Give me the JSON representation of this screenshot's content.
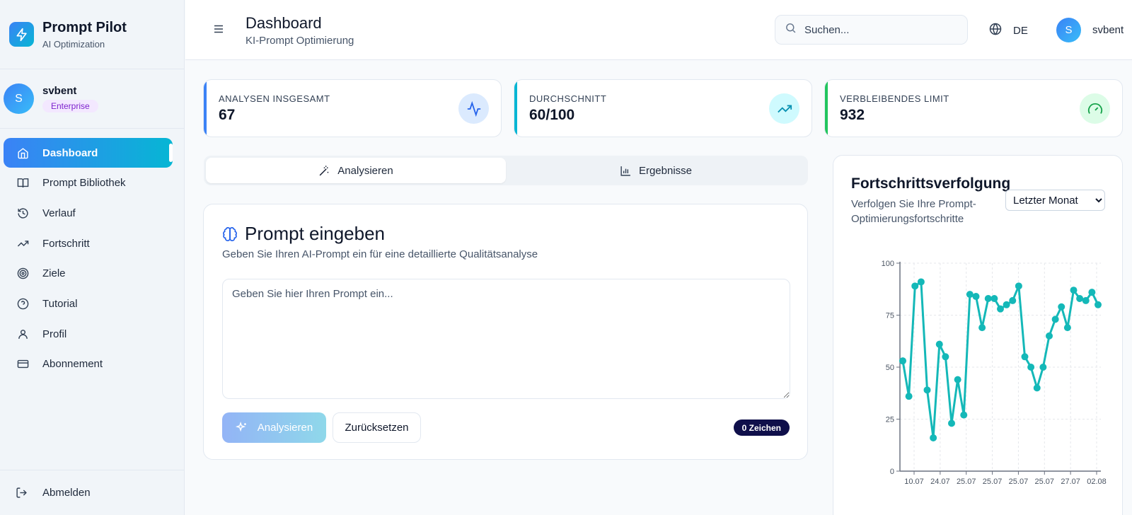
{
  "brand": {
    "title": "Prompt Pilot",
    "subtitle": "AI Optimization",
    "accent": "#3b82f6"
  },
  "user": {
    "name": "svbent",
    "initial": "S",
    "plan": "Enterprise"
  },
  "sidebar": {
    "items": [
      {
        "label": "Dashboard",
        "icon": "home-icon",
        "active": true
      },
      {
        "label": "Prompt Bibliothek",
        "icon": "book-icon"
      },
      {
        "label": "Verlauf",
        "icon": "history-icon"
      },
      {
        "label": "Fortschritt",
        "icon": "trending-up-icon"
      },
      {
        "label": "Ziele",
        "icon": "target-icon"
      },
      {
        "label": "Tutorial",
        "icon": "help-circle-icon"
      },
      {
        "label": "Profil",
        "icon": "user-icon"
      },
      {
        "label": "Abonnement",
        "icon": "credit-card-icon"
      }
    ],
    "logout": "Abmelden"
  },
  "header": {
    "title": "Dashboard",
    "subtitle": "KI-Prompt Optimierung",
    "search_placeholder": "Suchen...",
    "language": "DE"
  },
  "stats": [
    {
      "label": "Analysen insgesamt",
      "value": "67",
      "color": "#3b82f6"
    },
    {
      "label": "Durchschnitt",
      "value": "60/100",
      "color": "#06b6d4"
    },
    {
      "label": "Verbleibendes Limit",
      "value": "932",
      "color": "#22c55e"
    }
  ],
  "tabs": [
    {
      "label": "Analysieren",
      "active": true
    },
    {
      "label": "Ergebnisse"
    }
  ],
  "prompt_card": {
    "title": "Prompt eingeben",
    "subtitle": "Geben Sie Ihren AI-Prompt ein für eine detaillierte Qualitätsanalyse",
    "placeholder": "Geben Sie hier Ihren Prompt ein...",
    "value": "",
    "analyze_label": "Analysieren",
    "reset_label": "Zurücksetzen",
    "char_count": "0 Zeichen"
  },
  "progress_card": {
    "title": "Fortschrittsverfolgung",
    "subtitle": "Verfolgen Sie Ihre Prompt-Optimierungsfortschritte",
    "range_selected": "Letzter Monat"
  },
  "chart_data": {
    "type": "line",
    "title": "",
    "xlabel": "",
    "ylabel": "",
    "ylim": [
      0,
      100
    ],
    "yticks": [
      0,
      25,
      50,
      75,
      100
    ],
    "xticks": [
      "10.07",
      "24.07",
      "25.07",
      "25.07",
      "25.07",
      "25.07",
      "27.07",
      "02.08"
    ],
    "grid": true,
    "color": "#14b8b8",
    "values": [
      53,
      36,
      89,
      91,
      39,
      16,
      61,
      55,
      23,
      44,
      27,
      85,
      84,
      69,
      83,
      83,
      78,
      80,
      82,
      89,
      55,
      50,
      40,
      50,
      65,
      73,
      79,
      69,
      87,
      83,
      82,
      86,
      80
    ]
  }
}
